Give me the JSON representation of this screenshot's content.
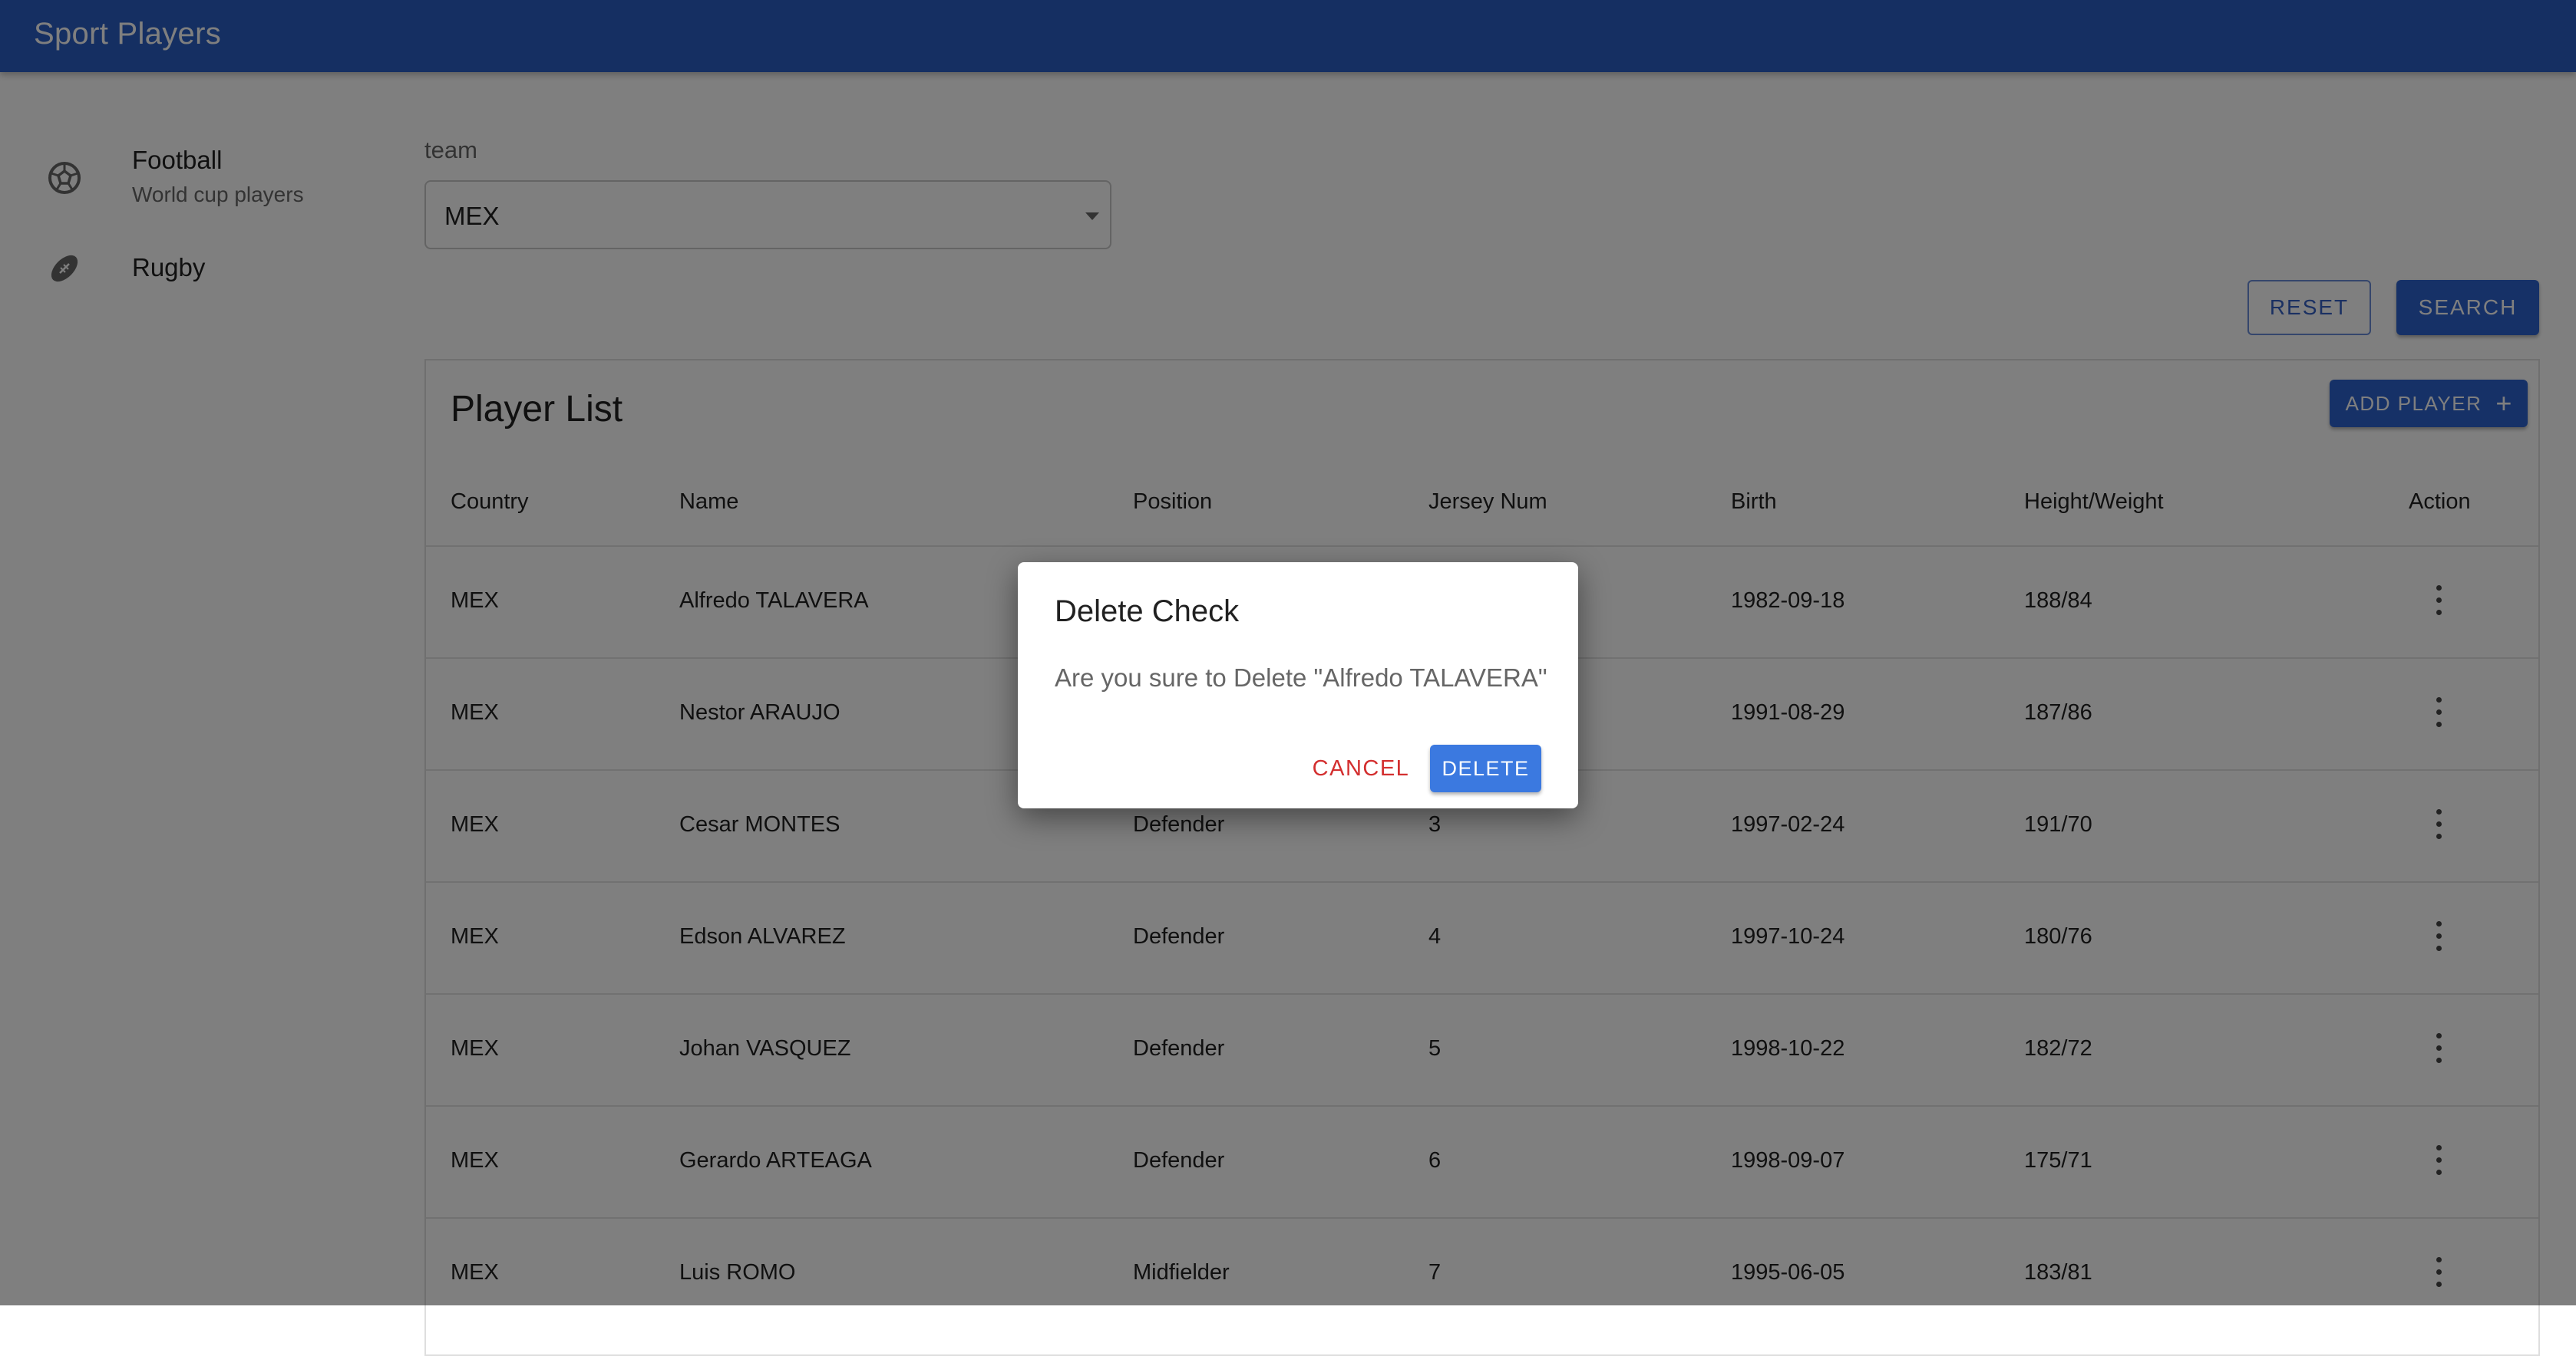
{
  "app": {
    "title": "Sport Players"
  },
  "sidebar": {
    "items": [
      {
        "label": "Football",
        "sublabel": "World cup players",
        "icon": "soccer-ball-icon"
      },
      {
        "label": "Rugby",
        "sublabel": "",
        "icon": "rugby-ball-icon"
      }
    ]
  },
  "filter": {
    "team_label": "team",
    "team_value": "MEX",
    "reset_label": "RESET",
    "search_label": "SEARCH"
  },
  "player_list": {
    "title": "Player List",
    "add_label": "ADD PLAYER",
    "add_icon": "plus-icon",
    "columns": [
      "Country",
      "Name",
      "Position",
      "Jersey Num",
      "Birth",
      "Height/Weight",
      "Action"
    ],
    "rows": [
      {
        "country": "MEX",
        "name": "Alfredo TALAVERA",
        "position": "",
        "jersey": "",
        "birth": "1982-09-18",
        "hw": "188/84"
      },
      {
        "country": "MEX",
        "name": "Nestor ARAUJO",
        "position": "",
        "jersey": "",
        "birth": "1991-08-29",
        "hw": "187/86"
      },
      {
        "country": "MEX",
        "name": "Cesar MONTES",
        "position": "Defender",
        "jersey": "3",
        "birth": "1997-02-24",
        "hw": "191/70"
      },
      {
        "country": "MEX",
        "name": "Edson ALVAREZ",
        "position": "Defender",
        "jersey": "4",
        "birth": "1997-10-24",
        "hw": "180/76"
      },
      {
        "country": "MEX",
        "name": "Johan VASQUEZ",
        "position": "Defender",
        "jersey": "5",
        "birth": "1998-10-22",
        "hw": "182/72"
      },
      {
        "country": "MEX",
        "name": "Gerardo ARTEAGA",
        "position": "Defender",
        "jersey": "6",
        "birth": "1998-09-07",
        "hw": "175/71"
      },
      {
        "country": "MEX",
        "name": "Luis ROMO",
        "position": "Midfielder",
        "jersey": "7",
        "birth": "1995-06-05",
        "hw": "183/81"
      }
    ]
  },
  "dialog": {
    "title": "Delete Check",
    "message": "Are you sure to Delete \"Alfredo TALAVERA\"",
    "cancel_label": "CANCEL",
    "delete_label": "DELETE"
  },
  "colors": {
    "primary": "#2a5fc4",
    "danger": "#d32f2f",
    "dialog_button": "#3b79e0"
  }
}
